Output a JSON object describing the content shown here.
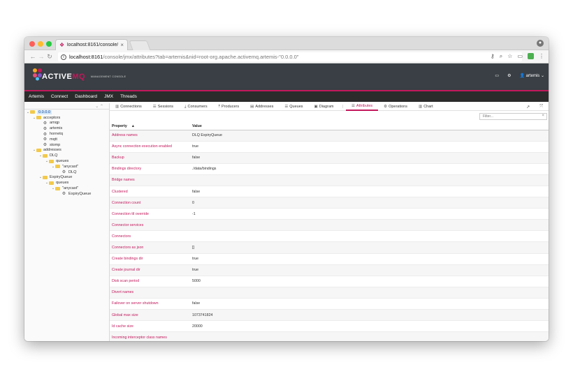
{
  "browser": {
    "tab_title": "localhost:8161/console/jmx/at",
    "url_host": "localhost:8161",
    "url_path": "/console/jmx/attributes?tab=artemis&nid=root-org.apache.activemq.artemis-\"0.0.0.0\""
  },
  "brand": {
    "logo_active": "ACTIVE",
    "logo_mq": "MQ",
    "logo_sub": "MANAGEMENT CONSOLE",
    "user": "artemis",
    "accent": "#c2185b"
  },
  "nav": [
    "Artemis",
    "Connect",
    "Dashboard",
    "JMX",
    "Threads"
  ],
  "tree": [
    {
      "label": "0.0.0.0",
      "level": 0,
      "type": "folder",
      "toggle": "v",
      "selected": true
    },
    {
      "label": "acceptors",
      "level": 1,
      "type": "folder",
      "toggle": "v"
    },
    {
      "label": "amqp",
      "level": 2,
      "type": "gear"
    },
    {
      "label": "artemis",
      "level": 2,
      "type": "gear"
    },
    {
      "label": "hornetq",
      "level": 2,
      "type": "gear"
    },
    {
      "label": "mqtt",
      "level": 2,
      "type": "gear"
    },
    {
      "label": "stomp",
      "level": 2,
      "type": "gear"
    },
    {
      "label": "addresses",
      "level": 1,
      "type": "folder",
      "toggle": "v"
    },
    {
      "label": "DLQ",
      "level": 2,
      "type": "folder",
      "toggle": "v"
    },
    {
      "label": "queues",
      "level": 3,
      "type": "folder",
      "toggle": "v"
    },
    {
      "label": "\"anycast\"",
      "level": 4,
      "type": "folder",
      "toggle": "v"
    },
    {
      "label": "DLQ",
      "level": 5,
      "type": "gear"
    },
    {
      "label": "ExpiryQueue",
      "level": 2,
      "type": "folder",
      "toggle": "v"
    },
    {
      "label": "queues",
      "level": 3,
      "type": "folder",
      "toggle": "v"
    },
    {
      "label": "\"anycast\"",
      "level": 4,
      "type": "folder",
      "toggle": "v"
    },
    {
      "label": "ExpiryQueue",
      "level": 5,
      "type": "gear"
    }
  ],
  "tabs": [
    {
      "label": "Connections",
      "icon": "chart-icon"
    },
    {
      "label": "Sessions",
      "icon": "list-icon"
    },
    {
      "label": "Consumers",
      "icon": "download-icon"
    },
    {
      "label": "Producers",
      "icon": "upload-icon"
    },
    {
      "label": "Addresses",
      "icon": "book-icon"
    },
    {
      "label": "Queues",
      "icon": "list-icon"
    },
    {
      "label": "Diagram",
      "icon": "image-icon"
    },
    {
      "label": "Attributes",
      "icon": "list-icon",
      "active": true
    },
    {
      "label": "Operations",
      "icon": "gear-icon"
    },
    {
      "label": "Chart",
      "icon": "chart-icon"
    }
  ],
  "filter_placeholder": "Filter...",
  "table": {
    "col_property": "Property",
    "col_value": "Value",
    "rows": [
      {
        "property": "Address names",
        "value": "DLQ ExpiryQueue"
      },
      {
        "property": "Async connection execution enabled",
        "value": "true"
      },
      {
        "property": "Backup",
        "value": "false"
      },
      {
        "property": "Bindings directory",
        "value": "./data/bindings"
      },
      {
        "property": "Bridge names",
        "value": ""
      },
      {
        "property": "Clustered",
        "value": "false"
      },
      {
        "property": "Connection count",
        "value": "0"
      },
      {
        "property": "Connection ttl override",
        "value": "-1"
      },
      {
        "property": "Connector services",
        "value": ""
      },
      {
        "property": "Connectors",
        "value": ""
      },
      {
        "property": "Connectors as json",
        "value": "[]"
      },
      {
        "property": "Create bindings dir",
        "value": "true"
      },
      {
        "property": "Create journal dir",
        "value": "true"
      },
      {
        "property": "Disk scan period",
        "value": "5000"
      },
      {
        "property": "Divert names",
        "value": ""
      },
      {
        "property": "Failover on server shutdown",
        "value": "false"
      },
      {
        "property": "Global max size",
        "value": "1073741824"
      },
      {
        "property": "Id cache size",
        "value": "20000"
      },
      {
        "property": "Incoming interceptor class names",
        "value": ""
      }
    ]
  }
}
